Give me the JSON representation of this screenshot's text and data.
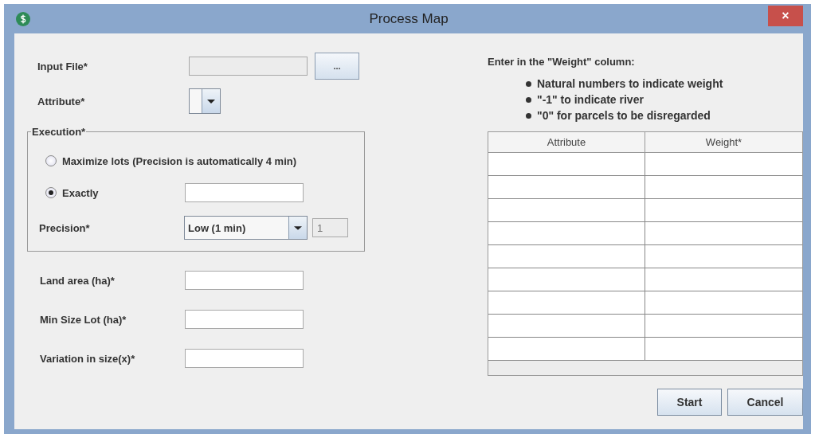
{
  "window": {
    "title": "Process Map",
    "close": "×"
  },
  "input_file": {
    "label": "Input File*",
    "browse": "..."
  },
  "attribute": {
    "label": "Attribute*"
  },
  "execution": {
    "legend": "Execution*",
    "options": [
      {
        "label": "Maximize lots (Precision is automatically 4 min)",
        "selected": false
      },
      {
        "label": "Exactly",
        "selected": true
      }
    ],
    "precision": {
      "label": "Precision*",
      "value": "Low (1 min)",
      "number": "1"
    }
  },
  "fields": [
    {
      "label": "Land area (ha)*"
    },
    {
      "label": "Min Size Lot (ha)*"
    },
    {
      "label": "Variation in size(x)*"
    }
  ],
  "instructions": {
    "heading": "Enter in the \"Weight\" column:",
    "bullets": [
      "Natural numbers to indicate weight",
      "\"-1\" to indicate river",
      "\"0\" for parcels to be disregarded"
    ]
  },
  "table": {
    "columns": [
      "Attribute",
      "Weight*"
    ]
  },
  "buttons": [
    "Start",
    "Cancel"
  ]
}
